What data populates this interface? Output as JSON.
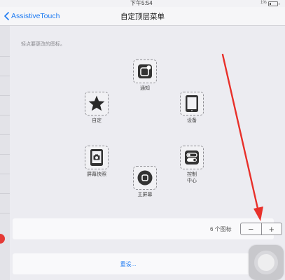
{
  "status_bar": {
    "time": "下午5:54",
    "battery_text": "1%"
  },
  "nav": {
    "back_label": "AssistiveTouch",
    "title": "自定顶层菜单"
  },
  "hint": "轻点要更改的图标。",
  "menu_items": [
    {
      "label": "通知",
      "icon": "notification-icon"
    },
    {
      "label": "设备",
      "icon": "device-icon"
    },
    {
      "label": "控制\n中心",
      "icon": "control-center-icon"
    },
    {
      "label": "主屏幕",
      "icon": "home-icon"
    },
    {
      "label": "屏幕快照",
      "icon": "screenshot-icon"
    },
    {
      "label": "自定",
      "icon": "star-icon"
    }
  ],
  "icon_count": {
    "label": "6 个图标",
    "minus": "−",
    "plus": "+"
  },
  "reset_label": "重设...",
  "colors": {
    "accent": "#1e7bf2",
    "arrow": "#e8302a"
  }
}
